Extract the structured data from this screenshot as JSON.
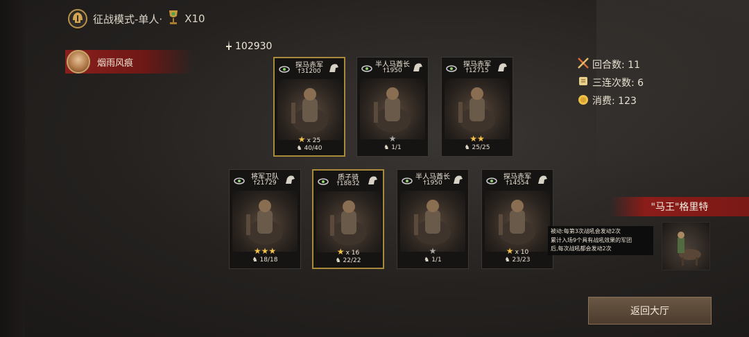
{
  "header": {
    "title": "征战模式-单人·",
    "multiplier": "X10",
    "helmet_icon": "spartan-helmet-icon",
    "trophy_icon": "trophy-icon"
  },
  "player": {
    "name": "烟雨风痕"
  },
  "total_power": "102930",
  "stats": {
    "rounds": "回合数: 11",
    "triple_combo": "三连次数: 6",
    "cost": "消费: 123"
  },
  "cards": [
    {
      "name": "探马赤军",
      "power": "31200",
      "stars": 1,
      "star_mult": "x 25",
      "troops": "40/40",
      "highlight": true
    },
    {
      "name": "半人马酋长",
      "power": "1950",
      "stars": 0,
      "star_mult": "",
      "troops": "1/1",
      "highlight": false
    },
    {
      "name": "探马赤军",
      "power": "12715",
      "stars": 2,
      "star_mult": "",
      "troops": "25/25",
      "highlight": false
    },
    {
      "name": "将军卫队",
      "power": "21729",
      "stars": 3,
      "star_mult": "",
      "troops": "18/18",
      "highlight": false
    },
    {
      "name": "质子骑",
      "power": "18832",
      "stars": 1,
      "star_mult": "x 16",
      "troops": "22/22",
      "highlight": true
    },
    {
      "name": "半人马酋长",
      "power": "1950",
      "stars": 0,
      "star_mult": "",
      "troops": "1/1",
      "highlight": false
    },
    {
      "name": "探马赤军",
      "power": "14554",
      "stars": 1,
      "star_mult": "x 10",
      "troops": "23/23",
      "highlight": false
    }
  ],
  "boss": {
    "name": "\"马王\"格里特",
    "tooltip_line1": "被动:每第3次战吼会发动2次",
    "tooltip_line2": "累计入场9个具有战吼效果的军团",
    "tooltip_line3": "后,每次战吼都会发动2次"
  },
  "return_button": "返回大厅",
  "colors": {
    "accent_red": "#8b1c19",
    "gold": "#f3c24a",
    "card_border_gold": "#a88a3a"
  }
}
